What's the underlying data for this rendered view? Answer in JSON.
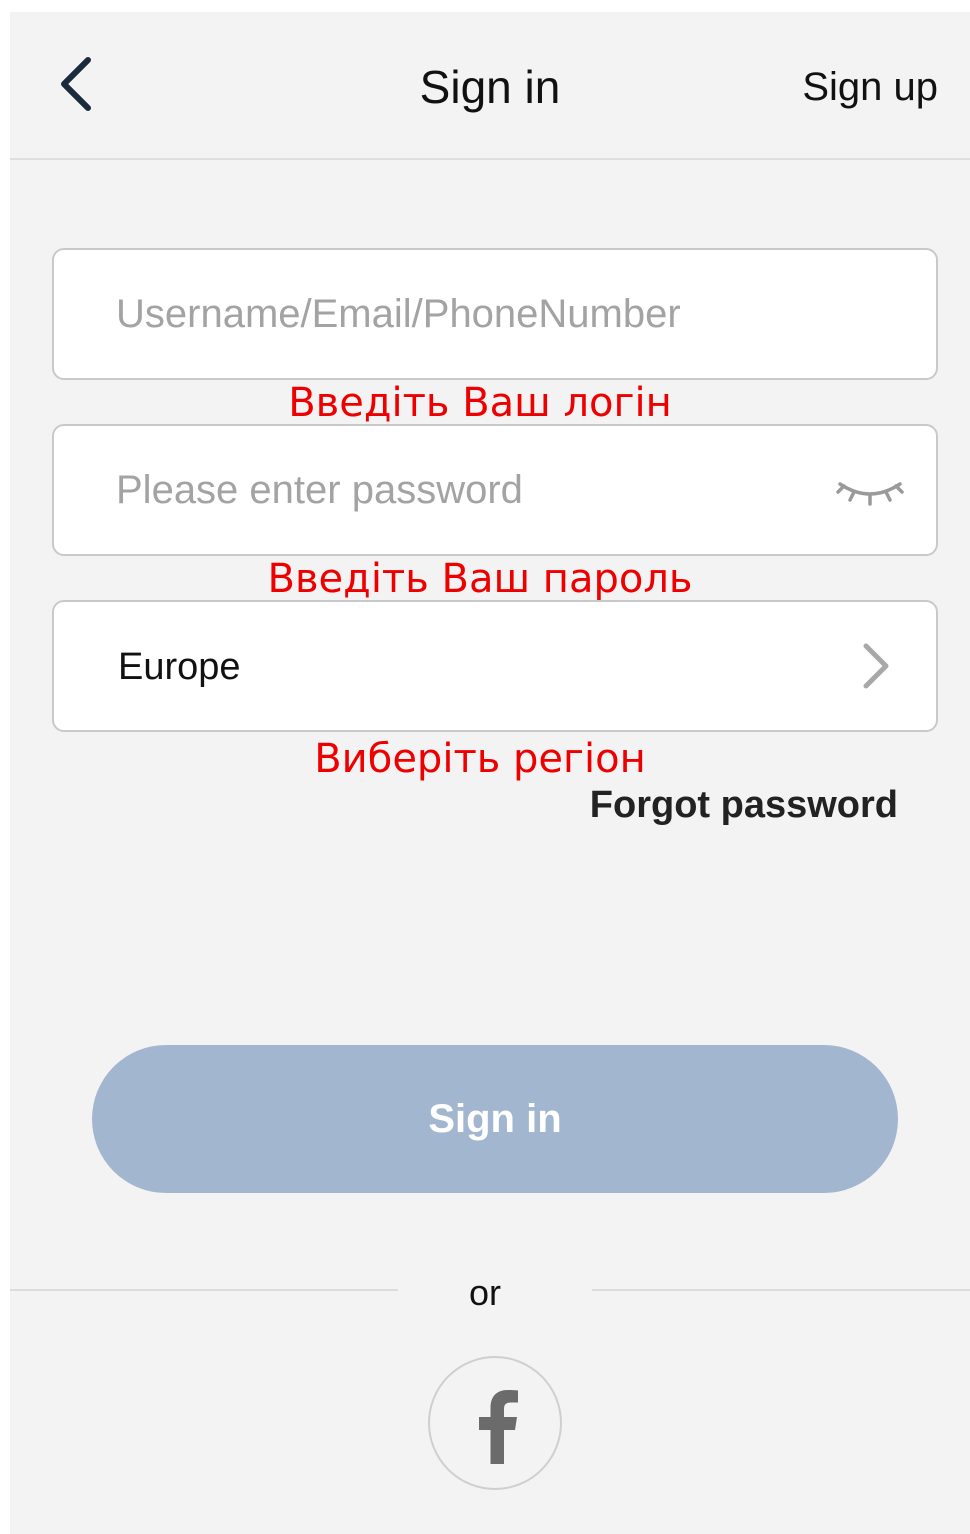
{
  "header": {
    "title": "Sign in",
    "signup_label": "Sign up",
    "back_icon": "chevron-left-icon"
  },
  "form": {
    "username": {
      "placeholder": "Username/Email/PhoneNumber",
      "value": ""
    },
    "password": {
      "placeholder": "Please enter password",
      "value": "",
      "toggle_icon": "eye-closed-icon"
    },
    "region": {
      "value": "Europe",
      "icon": "chevron-right-icon"
    },
    "forgot_label": "Forgot password",
    "submit_label": "Sign in"
  },
  "annotations": {
    "login": "Введіть Ваш логін",
    "password": "Введіть Ваш пароль",
    "region": "Виберіть регіон"
  },
  "social": {
    "or_label": "or",
    "facebook_icon": "facebook-icon"
  },
  "colors": {
    "background": "#f3f3f3",
    "button_disabled": "#a3b6cf",
    "annotation": "#ee0000",
    "header_icon": "#1c2a3d"
  }
}
